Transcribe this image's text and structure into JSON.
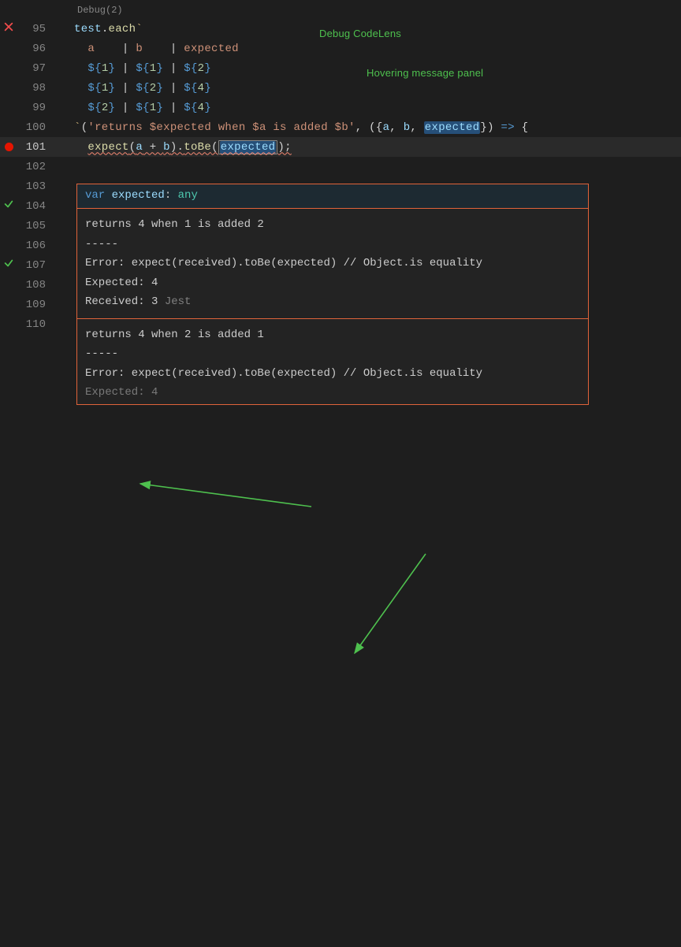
{
  "codelens": {
    "label": "Debug(2)"
  },
  "annotations": {
    "debug_codelens": "Debug CodeLens",
    "hover_panel": "Hovering message panel"
  },
  "lines": [
    {
      "num": "95",
      "indent": "",
      "icon": "fail",
      "tokens": [
        {
          "t": "test",
          "c": "pp"
        },
        {
          "t": ".",
          "c": "punc"
        },
        {
          "t": "each",
          "c": "mf"
        },
        {
          "t": "`",
          "c": "pt"
        }
      ]
    },
    {
      "num": "96",
      "indent": "  ",
      "tokens": [
        {
          "t": "a    ",
          "c": "str"
        },
        {
          "t": "|",
          "c": "pipe"
        },
        {
          "t": " b    ",
          "c": "str"
        },
        {
          "t": "|",
          "c": "pipe"
        },
        {
          "t": " expected",
          "c": "str"
        }
      ]
    },
    {
      "num": "97",
      "indent": "  ",
      "tokens": [
        {
          "t": "${",
          "c": "tpl"
        },
        {
          "t": "1",
          "c": "num"
        },
        {
          "t": "}",
          "c": "tpl"
        },
        {
          "t": " ",
          "c": "str"
        },
        {
          "t": "|",
          "c": "pipe"
        },
        {
          "t": " ",
          "c": "str"
        },
        {
          "t": "${",
          "c": "tpl"
        },
        {
          "t": "1",
          "c": "num"
        },
        {
          "t": "}",
          "c": "tpl"
        },
        {
          "t": " ",
          "c": "str"
        },
        {
          "t": "|",
          "c": "pipe"
        },
        {
          "t": " ",
          "c": "str"
        },
        {
          "t": "${",
          "c": "tpl"
        },
        {
          "t": "2",
          "c": "num"
        },
        {
          "t": "}",
          "c": "tpl"
        }
      ]
    },
    {
      "num": "98",
      "indent": "  ",
      "tokens": [
        {
          "t": "${",
          "c": "tpl"
        },
        {
          "t": "1",
          "c": "num"
        },
        {
          "t": "}",
          "c": "tpl"
        },
        {
          "t": " ",
          "c": "str"
        },
        {
          "t": "|",
          "c": "pipe"
        },
        {
          "t": " ",
          "c": "str"
        },
        {
          "t": "${",
          "c": "tpl"
        },
        {
          "t": "2",
          "c": "num"
        },
        {
          "t": "}",
          "c": "tpl"
        },
        {
          "t": " ",
          "c": "str"
        },
        {
          "t": "|",
          "c": "pipe"
        },
        {
          "t": " ",
          "c": "str"
        },
        {
          "t": "${",
          "c": "tpl"
        },
        {
          "t": "4",
          "c": "num"
        },
        {
          "t": "}",
          "c": "tpl"
        }
      ]
    },
    {
      "num": "99",
      "indent": "  ",
      "tokens": [
        {
          "t": "${",
          "c": "tpl"
        },
        {
          "t": "2",
          "c": "num"
        },
        {
          "t": "}",
          "c": "tpl"
        },
        {
          "t": " ",
          "c": "str"
        },
        {
          "t": "|",
          "c": "pipe"
        },
        {
          "t": " ",
          "c": "str"
        },
        {
          "t": "${",
          "c": "tpl"
        },
        {
          "t": "1",
          "c": "num"
        },
        {
          "t": "}",
          "c": "tpl"
        },
        {
          "t": " ",
          "c": "str"
        },
        {
          "t": "|",
          "c": "pipe"
        },
        {
          "t": " ",
          "c": "str"
        },
        {
          "t": "${",
          "c": "tpl"
        },
        {
          "t": "4",
          "c": "num"
        },
        {
          "t": "}",
          "c": "tpl"
        }
      ]
    },
    {
      "num": "100",
      "indent": "",
      "tokens": [
        {
          "t": "`",
          "c": "pt"
        },
        {
          "t": "(",
          "c": "punc"
        },
        {
          "t": "'returns $expected when $a is added $b'",
          "c": "str"
        },
        {
          "t": ", ({",
          "c": "punc"
        },
        {
          "t": "a",
          "c": "pp"
        },
        {
          "t": ", ",
          "c": "punc"
        },
        {
          "t": "b",
          "c": "pp"
        },
        {
          "t": ", ",
          "c": "punc"
        },
        {
          "t": "expected",
          "c": "pp",
          "sel": true
        },
        {
          "t": "}) ",
          "c": "punc"
        },
        {
          "t": "=>",
          "c": "tpl"
        },
        {
          "t": " {",
          "c": "punc"
        }
      ]
    },
    {
      "num": "101",
      "indent": "  ",
      "icon": "breakpoint",
      "current": true,
      "tokens": [
        {
          "t": "expect",
          "c": "mf",
          "wavy": true
        },
        {
          "t": "(",
          "c": "punc",
          "wavy": true
        },
        {
          "t": "a",
          "c": "pp",
          "wavy": true
        },
        {
          "t": " + ",
          "c": "punc",
          "wavy": true
        },
        {
          "t": "b",
          "c": "pp",
          "wavy": true
        },
        {
          "t": ").",
          "c": "punc",
          "wavy": true
        },
        {
          "t": "toBe",
          "c": "mf",
          "wavy": true
        },
        {
          "t": "(",
          "c": "punc",
          "wavy": true
        },
        {
          "t": "expected",
          "c": "pp",
          "wavy": true,
          "cursor": true,
          "sel": true
        },
        {
          "t": ");",
          "c": "punc",
          "wavy": true
        }
      ]
    },
    {
      "num": "102"
    },
    {
      "num": "103"
    },
    {
      "num": "104",
      "icon": "pass"
    },
    {
      "num": "105"
    },
    {
      "num": "106"
    },
    {
      "num": "107",
      "icon": "pass"
    },
    {
      "num": "108"
    },
    {
      "num": "109"
    },
    {
      "num": "110"
    }
  ],
  "hover": {
    "signature": {
      "keyword": "var",
      "name": "expected",
      "sep": ": ",
      "type": "any"
    },
    "messages": [
      {
        "title": "returns 4 when 1 is added 2",
        "dashes": "-----",
        "error": "Error: expect(received).toBe(expected) // Object.is equality",
        "blank": "",
        "expected": "Expected: 4",
        "received_prefix": "Received: 3 ",
        "received_suffix": "Jest"
      },
      {
        "title": "returns 4 when 2 is added 1",
        "dashes": "-----",
        "error": "Error: expect(received).toBe(expected) // Object.is equality",
        "blank": "",
        "partial": "Expected: 4"
      }
    ]
  }
}
